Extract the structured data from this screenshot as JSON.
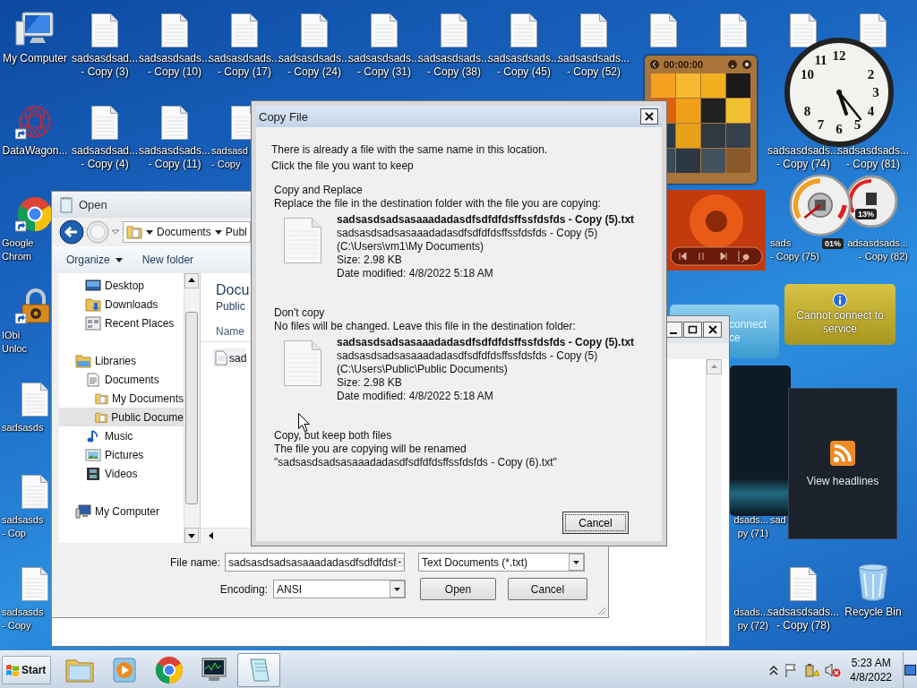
{
  "desktop": {
    "columns": [
      [
        {
          "kind": "computer",
          "lines": [
            "My Computer"
          ]
        },
        {
          "kind": "datawagon",
          "lines": [
            "DataWagon..."
          ]
        },
        {
          "kind": "chrome",
          "lines": [
            "Google",
            "Chrom"
          ],
          "cut_right": true
        },
        {
          "kind": "iobit",
          "lines": [
            "IObi",
            "Unloc"
          ],
          "cut_right": true
        },
        {
          "kind": "file",
          "lines": [
            "sadsasds"
          ],
          "cut_right": true
        },
        {
          "kind": "file",
          "lines": [
            "sadsasds",
            "- Cop"
          ],
          "cut_right": true
        },
        {
          "kind": "file",
          "lines": [
            "sadsasds",
            "- Copy"
          ],
          "cut_right": true
        }
      ],
      [
        {
          "kind": "file",
          "lines": [
            "sadsasdsad...",
            "- Copy (3)"
          ]
        },
        {
          "kind": "file",
          "lines": [
            "sadsasdsad...",
            "- Copy (4)"
          ]
        },
        null,
        null,
        null,
        null,
        null
      ],
      [
        {
          "kind": "file",
          "lines": [
            "sadsasdsads...",
            "- Copy (10)"
          ]
        },
        {
          "kind": "file",
          "lines": [
            "sadsasdsads...",
            "- Copy (11)"
          ]
        },
        null,
        null,
        null,
        null,
        null
      ],
      [
        {
          "kind": "file",
          "lines": [
            "sadsasdsads...",
            "- Copy (17)"
          ]
        },
        {
          "kind": "file",
          "lines": [
            "sadsasd",
            "- Copy"
          ],
          "cut_right": true
        },
        null,
        null,
        null,
        null,
        null
      ],
      [
        {
          "kind": "file",
          "lines": [
            "sadsasdsads...",
            "- Copy (24)"
          ]
        },
        null,
        null,
        null,
        null,
        null,
        null
      ],
      [
        {
          "kind": "file",
          "lines": [
            "sadsasdsads...",
            "- Copy (31)"
          ]
        },
        null,
        null,
        null,
        null,
        null,
        null
      ],
      [
        {
          "kind": "file",
          "lines": [
            "sadsasdsads...",
            "- Copy (38)"
          ]
        },
        null,
        null,
        null,
        null,
        null,
        null
      ],
      [
        {
          "kind": "file",
          "lines": [
            "sadsasdsads...",
            "- Copy (45)"
          ]
        },
        null,
        null,
        null,
        null,
        null,
        null
      ],
      [
        {
          "kind": "file",
          "lines": [
            "sadsasdsads...",
            "- Copy (52)"
          ]
        },
        null,
        null,
        null,
        null,
        null,
        null
      ],
      [
        {
          "kind": "file"
        },
        null,
        null,
        null,
        null,
        null,
        null
      ],
      [
        {
          "kind": "file"
        },
        null,
        null,
        null,
        null,
        {
          "lines": [
            "dsads...",
            "py (71)"
          ],
          "cut_left": true
        },
        {
          "lines": [
            "dsads...",
            "py (72)"
          ],
          "cut_left": true
        }
      ],
      [
        {
          "kind": "file"
        },
        {
          "lines": [
            "sadsasdsads...",
            "- Copy (74)"
          ]
        },
        {
          "lines": [
            "sads",
            "- Copy (75)"
          ],
          "cut_right": true
        },
        null,
        null,
        {
          "lines": [
            "sad"
          ],
          "cut_right": true
        },
        {
          "kind": "file",
          "lines": [
            "sadsasdsads...",
            "- Copy (78)"
          ]
        }
      ],
      [
        {
          "kind": "file"
        },
        {
          "lines": [
            "sadsasdsads...",
            "- Copy (81)"
          ]
        },
        {
          "lines": [
            "adsasdsads...",
            "- Copy (82)"
          ],
          "cut_left": true
        },
        null,
        null,
        null,
        {
          "kind": "recycle",
          "lines": [
            "Recycle Bin"
          ]
        }
      ]
    ]
  },
  "gadgets": {
    "puzzle": {
      "timer": "00:00:00"
    },
    "clock": {
      "numerals": [
        "12",
        "2",
        "3",
        "4",
        "5",
        "6",
        "7",
        "8",
        "10",
        "11"
      ]
    },
    "cpu_meter": {
      "readings": [
        "01%",
        "13%"
      ]
    },
    "weather_behind": {
      "lines": [
        "connect",
        "ce"
      ]
    },
    "weather": {
      "message": "Cannot connect to service"
    },
    "feed": {
      "label": "View headlines"
    }
  },
  "open_dialog": {
    "title": "Open",
    "breadcrumb": [
      "Documents",
      "Publ"
    ],
    "toolbar": [
      "Organize",
      "New folder"
    ],
    "nav_tree": [
      {
        "children": [
          {
            "label": "Desktop",
            "kind": "desktop",
            "selected": false
          },
          {
            "label": "Downloads",
            "kind": "downloads",
            "selected": false
          },
          {
            "label": "Recent Places",
            "kind": "recent",
            "selected": false
          }
        ]
      },
      {
        "label": "Libraries",
        "kind": "libraries",
        "selected": false,
        "children": [
          {
            "label": "Documents",
            "kind": "documents",
            "selected": false,
            "children": [
              {
                "label": "My Documents",
                "kind": "folder",
                "selected": false
              },
              {
                "label": "Public Docume",
                "kind": "folder",
                "selected": true
              }
            ]
          },
          {
            "label": "Music",
            "kind": "music",
            "selected": false
          },
          {
            "label": "Pictures",
            "kind": "pictures",
            "selected": false
          },
          {
            "label": "Videos",
            "kind": "videos",
            "selected": false
          }
        ]
      },
      {
        "label": "My Computer",
        "kind": "computer",
        "selected": false
      }
    ],
    "content": {
      "heading": "Docu",
      "subheading": "Public",
      "column": "Name",
      "files": [
        "sad"
      ]
    },
    "file_name_label": "File name:",
    "file_name": "sadsasdsadsasaaadadasdfsdfdfdsf",
    "file_type": "Text Documents (*.txt)",
    "encoding_label": "Encoding:",
    "encoding": "ANSI",
    "buttons": [
      "Open",
      "Cancel"
    ]
  },
  "copy_dialog": {
    "title": "Copy File",
    "intro": [
      "There is already a file with the same name in this location.",
      "Click the file you want to keep"
    ],
    "options": [
      {
        "kind": "file",
        "title": "Copy and Replace",
        "description": "Replace the file in the destination folder with the file you are copying:",
        "file_name": "sadsasdsadsasaaadadasdfsdfdfdsffssfdsfds - Copy (5).txt",
        "details": [
          "sadsasdsadsasaaadadasdfsdfdfdsffssfdsfds - Copy (5)",
          "(C:\\Users\\vm1\\My Documents)",
          "Size: 2.98 KB",
          "Date modified: 4/8/2022 5:18 AM"
        ]
      },
      {
        "kind": "file",
        "title": "Don't copy",
        "description": "No files will be changed. Leave this file in the destination folder:",
        "file_name": "sadsasdsadsasaaadadasdfsdfdfdsffssfdsfds - Copy (5).txt",
        "details": [
          "sadsasdsadsasaaadadasdfsdfdfdsffssfdsfds - Copy (5)",
          "(C:\\Users\\Public\\Public Documents)",
          "Size: 2.98 KB",
          "Date modified: 4/8/2022 5:18 AM"
        ]
      },
      {
        "kind": "rename",
        "title": "Copy, but keep both files",
        "description": "The file you are copying will be renamed",
        "new_name": "\"sadsasdsadsasaaadadasdfsdfdfdsffssfdsfds - Copy (6).txt\""
      }
    ],
    "button": "Cancel"
  },
  "taskbar": {
    "start": "Start",
    "apps": [
      {
        "kind": "explorer",
        "selected": false
      },
      {
        "kind": "media",
        "selected": false
      },
      {
        "kind": "chrome",
        "selected": false
      },
      {
        "kind": "monitor",
        "selected": false
      },
      {
        "kind": "notepad",
        "selected": true
      }
    ],
    "time": "5:23 AM",
    "date": "4/8/2022"
  }
}
